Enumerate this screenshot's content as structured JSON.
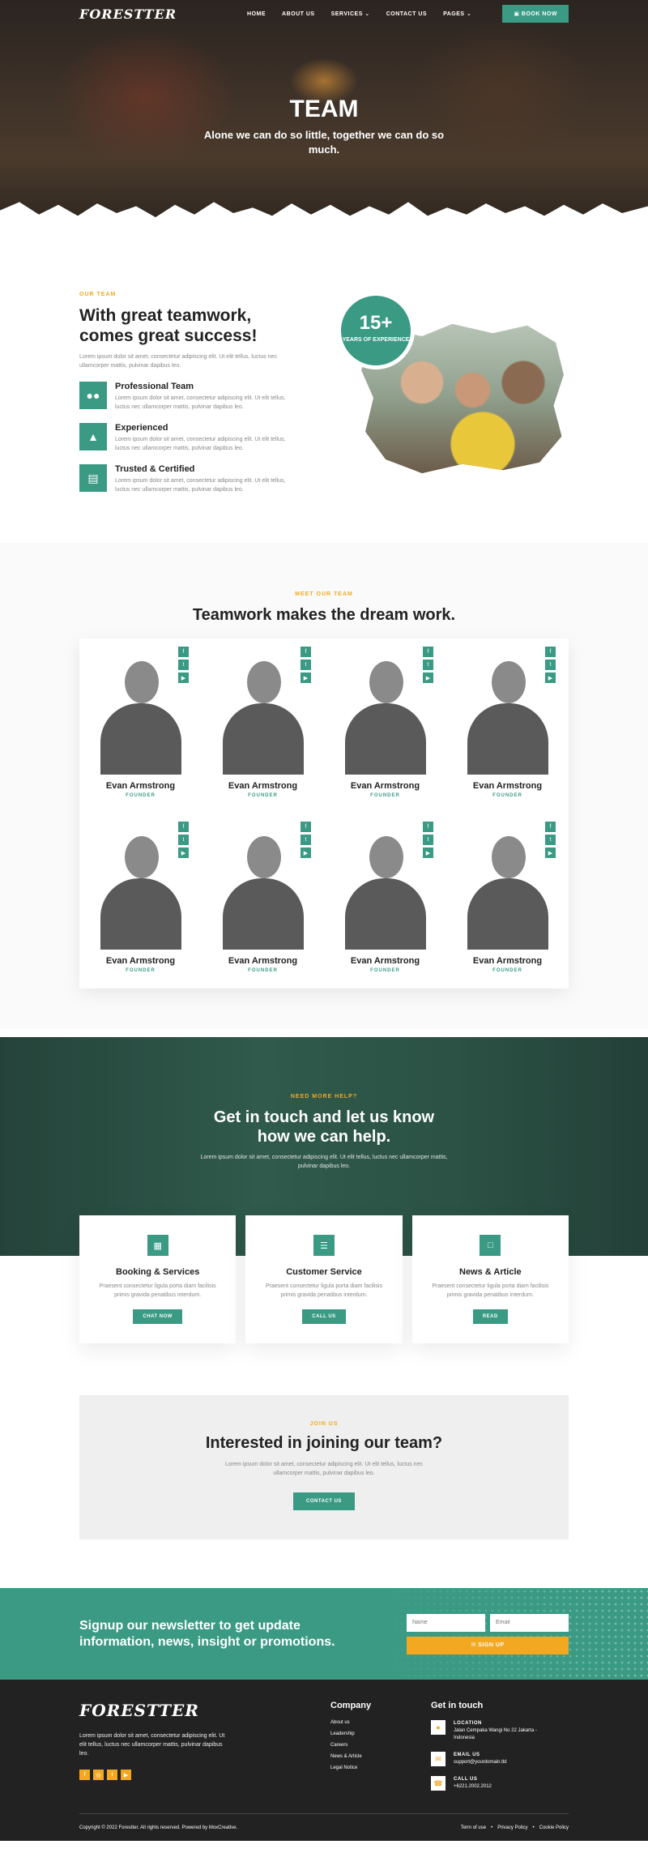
{
  "nav": {
    "logo": "FORESTTER",
    "links": [
      "HOME",
      "ABOUT US",
      "SERVICES ⌄",
      "CONTACT US",
      "PAGES ⌄"
    ],
    "book_button": "▣ BOOK NOW"
  },
  "hero": {
    "title": "TEAM",
    "subtitle": "Alone we can do so little, together we can do so much."
  },
  "about": {
    "eyebrow": "OUR TEAM",
    "title": "With great teamwork, comes great success!",
    "text": "Lorem ipsum dolor sit amet, consectetur adipiscing elit. Ut elit tellus, luctus nec ullamcorper mattis, pulvinar dapibus leo.",
    "features": [
      {
        "title": "Professional Team",
        "text": "Lorem ipsum dolor sit amet, consectetur adipiscing elit. Ut elit tellus, luctus nec ullamcorper mattis, pulvinar dapibus leo.",
        "icon": "users-icon"
      },
      {
        "title": "Experienced",
        "text": "Lorem ipsum dolor sit amet, consectetur adipiscing elit. Ut elit tellus, luctus nec ullamcorper mattis, pulvinar dapibus leo.",
        "icon": "campfire-icon"
      },
      {
        "title": "Trusted & Certified",
        "text": "Lorem ipsum dolor sit amet, consectetur adipiscing elit. Ut elit tellus, luctus nec ullamcorper mattis, pulvinar dapibus leo.",
        "icon": "certificate-icon"
      }
    ],
    "badge": {
      "number": "15+",
      "label": "YEARS OF EXPERIENCE"
    }
  },
  "meet": {
    "eyebrow": "MEET OUR TEAM",
    "title": "Teamwork makes the dream work.",
    "members": [
      {
        "name": "Evan Armstrong",
        "role": "FOUNDER"
      },
      {
        "name": "Evan Armstrong",
        "role": "FOUNDER"
      },
      {
        "name": "Evan Armstrong",
        "role": "FOUNDER"
      },
      {
        "name": "Evan Armstrong",
        "role": "FOUNDER"
      },
      {
        "name": "Evan Armstrong",
        "role": "FOUNDER"
      },
      {
        "name": "Evan Armstrong",
        "role": "FOUNDER"
      },
      {
        "name": "Evan Armstrong",
        "role": "FOUNDER"
      },
      {
        "name": "Evan Armstrong",
        "role": "FOUNDER"
      }
    ]
  },
  "contact": {
    "eyebrow": "NEED MORE HELP?",
    "title": "Get in touch and let us know how we can help.",
    "text": "Lorem ipsum dolor sit amet, consectetur adipiscing elit. Ut elit tellus, luctus nec ullamcorper mattis, pulvinar dapibus leo.",
    "cards": [
      {
        "title": "Booking & Services",
        "text": "Praesent consectetur ligula porta diam facilisis primis gravida penatibus interdum.",
        "button": "CHAT NOW",
        "icon": "calendar-icon"
      },
      {
        "title": "Customer Service",
        "text": "Praesent consectetur ligula porta diam facilisis primis gravida penatibus interdum.",
        "button": "CALL US",
        "icon": "chat-icon"
      },
      {
        "title": "News & Article",
        "text": "Praesent consectetur ligula porta diam facilisis primis gravida penatibus interdum.",
        "button": "READ",
        "icon": "document-icon"
      }
    ]
  },
  "join": {
    "eyebrow": "JOIN US",
    "title": "Interested in joining our team?",
    "text": "Lorem ipsum dolor sit amet, consectetur adipiscing elit. Ut elit tellus, luctus nec ullamcorper mattis, pulvinar dapibus leo.",
    "button": "CONTACT US"
  },
  "newsletter": {
    "title": "Signup our newsletter to get update information, news, insight or promotions.",
    "name_placeholder": "Name",
    "email_placeholder": "Email",
    "button": "✉ SIGN UP"
  },
  "footer": {
    "logo": "FORESTTER",
    "text": "Lorem ipsum dolor sit amet, consectetur adipiscing elit. Ut elit tellus, luctus nec ullamcorper mattis, pulvinar dapibus leo.",
    "company_heading": "Company",
    "company_links": [
      "About us",
      "Leadership",
      "Careers",
      "News & Article",
      "Legal Notice"
    ],
    "touch_heading": "Get in touch",
    "location_label": "LOCATION",
    "location_value": "Jalan Cempaka Wangi No 22 Jakarta - Indonesia",
    "email_label": "EMAIL US",
    "email_value": "support@yourdomain.tld",
    "call_label": "CALL US",
    "call_value": "+6221.2002.2012",
    "copyright": "Copyright © 2022 Forestter. All rights reserved. Powered by MoxCreative.",
    "legal_links": [
      "Term of use",
      "Privacy Policy",
      "Cookie Policy"
    ]
  },
  "colors": {
    "accent": "#3a9a84",
    "highlight": "#f2a921",
    "dark": "#222222"
  }
}
